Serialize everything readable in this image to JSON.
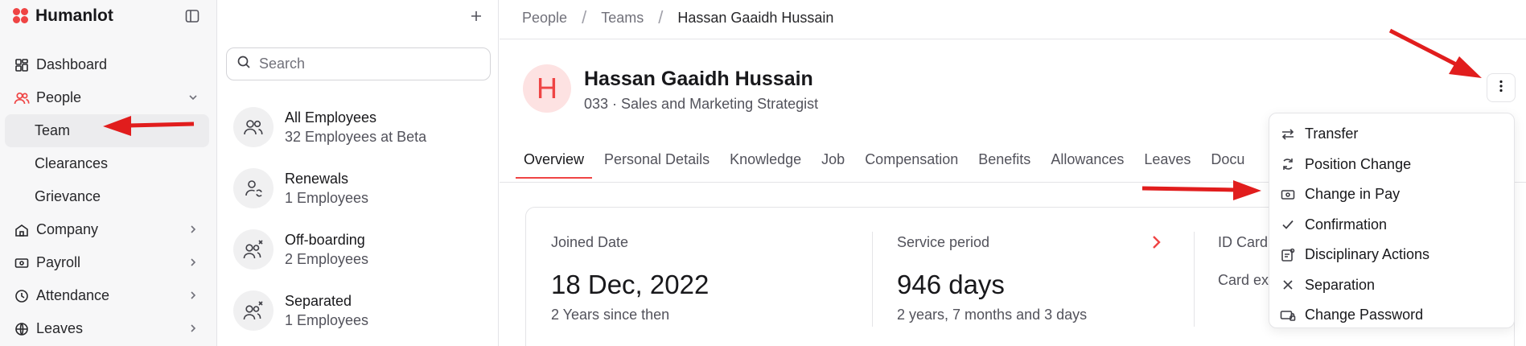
{
  "app": {
    "name": "Humanlot"
  },
  "colors": {
    "accent": "#ef4444",
    "arrow": "#e11d1d"
  },
  "sidebar": {
    "items": [
      {
        "label": "Dashboard",
        "icon": "dashboard-icon"
      },
      {
        "label": "People",
        "icon": "people-icon"
      },
      {
        "label": "Team"
      },
      {
        "label": "Clearances"
      },
      {
        "label": "Grievance"
      },
      {
        "label": "Company",
        "icon": "building-icon"
      },
      {
        "label": "Payroll",
        "icon": "payroll-icon"
      },
      {
        "label": "Attendance",
        "icon": "clock-icon"
      },
      {
        "label": "Leaves",
        "icon": "globe-icon"
      }
    ]
  },
  "middle": {
    "search_placeholder": "Search",
    "lists": [
      {
        "title": "All Employees",
        "subtitle": "32 Employees at Beta"
      },
      {
        "title": "Renewals",
        "subtitle": "1 Employees"
      },
      {
        "title": "Off-boarding",
        "subtitle": "2 Employees"
      },
      {
        "title": "Separated",
        "subtitle": "1 Employees"
      }
    ]
  },
  "breadcrumb": {
    "items": [
      "People",
      "Teams",
      "Hassan Gaaidh Hussain"
    ]
  },
  "profile": {
    "initial": "H",
    "name": "Hassan Gaaidh Hussain",
    "subtitle": "033 · Sales and Marketing Strategist"
  },
  "tabs": [
    "Overview",
    "Personal Details",
    "Knowledge",
    "Job",
    "Compensation",
    "Benefits",
    "Allowances",
    "Leaves",
    "Docu"
  ],
  "summary": {
    "joined": {
      "label": "Joined Date",
      "value": "18 Dec, 2022",
      "sub": "2 Years since then"
    },
    "service": {
      "label": "Service period",
      "value": "946 days",
      "sub": "2 years, 7 months and 3 days"
    },
    "idcard": {
      "label": "ID Card",
      "sub": "Card ex"
    }
  },
  "actions_menu": {
    "items": [
      {
        "label": "Transfer",
        "icon": "transfer-icon"
      },
      {
        "label": "Position Change",
        "icon": "position-change-icon"
      },
      {
        "label": "Change in Pay",
        "icon": "money-icon"
      },
      {
        "label": "Confirmation",
        "icon": "check-icon"
      },
      {
        "label": "Disciplinary Actions",
        "icon": "disciplinary-icon"
      },
      {
        "label": "Separation",
        "icon": "x-icon"
      },
      {
        "label": "Change Password",
        "icon": "password-icon"
      }
    ]
  }
}
